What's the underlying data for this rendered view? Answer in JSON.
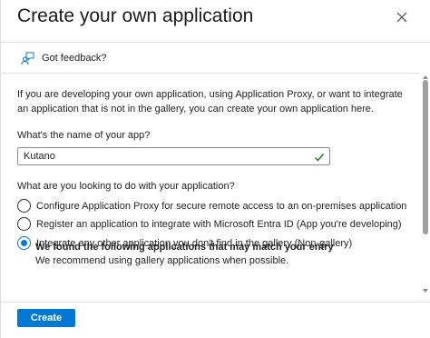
{
  "header": {
    "title": "Create your own application",
    "close_icon": "close-icon"
  },
  "feedback": {
    "label": "Got feedback?",
    "icon": "feedback-person-icon"
  },
  "intro_text": "If you are developing your own application, using Application Proxy, or want to integrate an application that is not in the gallery, you can create your own application here.",
  "name_field": {
    "label": "What's the name of your app?",
    "value": "Kutano",
    "valid_icon": "checkmark-icon"
  },
  "purpose": {
    "label": "What are you looking to do with your application?",
    "options": [
      {
        "label": "Configure Application Proxy for secure remote access to an on-premises application",
        "selected": false
      },
      {
        "label": "Register an application to integrate with Microsoft Entra ID (App you're developing)",
        "selected": false
      },
      {
        "label": "Integrate any other application you don't find in the gallery (Non-gallery)",
        "selected": true
      }
    ]
  },
  "notice": {
    "title": "We found the following applications that may match your entry",
    "subtitle": "We recommend using gallery applications when possible."
  },
  "footer": {
    "create_label": "Create"
  },
  "colors": {
    "accent": "#0078d4",
    "valid": "#107c10",
    "text": "#242424",
    "divider": "#e1dfdd"
  }
}
